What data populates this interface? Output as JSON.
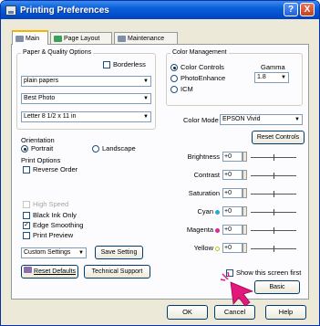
{
  "window": {
    "title": "Printing Preferences",
    "help_label": "?",
    "close_label": "X"
  },
  "tabs": [
    {
      "label": "Main"
    },
    {
      "label": "Page Layout"
    },
    {
      "label": "Maintenance"
    }
  ],
  "paper_quality": {
    "group_title": "Paper & Quality Options",
    "borderless_label": "Borderless",
    "media_type": "plain papers",
    "quality": "Best Photo",
    "paper_size": "Letter 8 1/2 x 11 in"
  },
  "orientation": {
    "title": "Orientation",
    "portrait": "Portrait",
    "landscape": "Landscape"
  },
  "print_options": {
    "title": "Print Options",
    "reverse_order": "Reverse Order",
    "high_speed": "High Speed",
    "black_ink_only": "Black Ink Only",
    "edge_smoothing": "Edge Smoothing",
    "print_preview": "Print Preview"
  },
  "custom_settings": {
    "value": "Custom Settings",
    "save_label": "Save Setting"
  },
  "reset_defaults_label": "Reset Defaults",
  "technical_support_label": "Technical Support",
  "color_management": {
    "group_title": "Color Management",
    "color_controls": "Color Controls",
    "photo_enhance": "PhotoEnhance",
    "icm": "ICM",
    "gamma_label": "Gamma",
    "gamma_value": "1.8",
    "color_mode_label": "Color Mode",
    "color_mode_value": "EPSON Vivid",
    "reset_controls_label": "Reset Controls"
  },
  "sliders": [
    {
      "label": "Brightness",
      "value": "+0",
      "dot_color": ""
    },
    {
      "label": "Contrast",
      "value": "+0",
      "dot_color": ""
    },
    {
      "label": "Saturation",
      "value": "+0",
      "dot_color": ""
    },
    {
      "label": "Cyan",
      "value": "+0",
      "dot_color": "#29a9d8"
    },
    {
      "label": "Magenta",
      "value": "+0",
      "dot_color": "#d82a9a"
    },
    {
      "label": "Yellow",
      "value": "+0",
      "dot_color": "#c9c814"
    }
  ],
  "show_screen_first_label": "Show this screen first",
  "basic_label": "Basic",
  "footer": {
    "ok": "OK",
    "cancel": "Cancel",
    "help": "Help"
  },
  "colors": {
    "titlebar": "#0a5fd8",
    "cursor": "#e0197a"
  }
}
